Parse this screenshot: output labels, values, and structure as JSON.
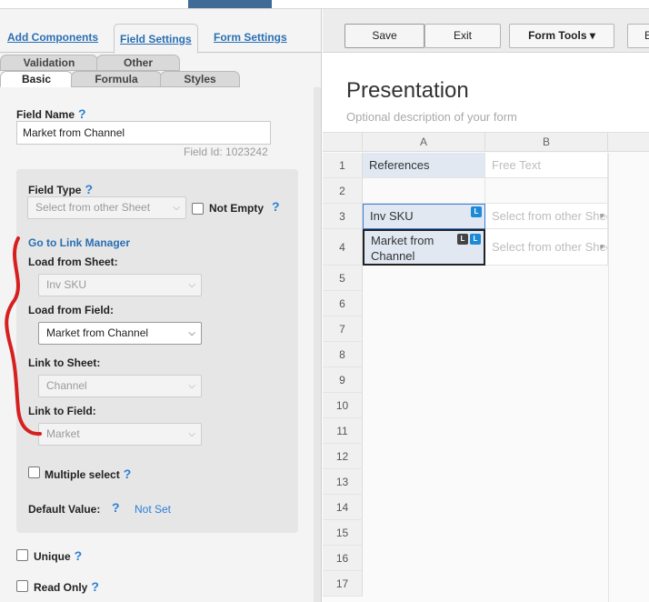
{
  "top_tabs": {
    "add_components": "Add Components",
    "field_settings": "Field Settings",
    "form_settings": "Form Settings"
  },
  "sub_tabs": {
    "validation": "Validation",
    "other": "Other",
    "basic": "Basic",
    "formula": "Formula",
    "styles": "Styles"
  },
  "field": {
    "name_label": "Field Name",
    "name_value": "Market from Channel",
    "field_id": "Field Id: 1023242",
    "type_label": "Field Type",
    "type_value": "Select from other Sheet",
    "not_empty_label": "Not Empty",
    "link_manager": "Go to Link Manager",
    "load_sheet_label": "Load from Sheet:",
    "load_sheet_value": "Inv SKU",
    "load_field_label": "Load from Field:",
    "load_field_value": "Market from Channel",
    "link_sheet_label": "Link to Sheet:",
    "link_sheet_value": "Channel",
    "link_field_label": "Link to Field:",
    "link_field_value": "Market",
    "multiple_select_label": "Multiple select",
    "default_value_label": "Default Value:",
    "default_value": "Not Set",
    "unique_label": "Unique",
    "read_only_label": "Read Only",
    "help": "?"
  },
  "toolbar": {
    "save": "Save",
    "exit": "Exit",
    "form_tools": "Form Tools",
    "caret": "▾",
    "partial": "E"
  },
  "form": {
    "title": "Presentation",
    "description": "Optional description of your form"
  },
  "grid": {
    "col_a": "A",
    "col_b": "B",
    "rows": [
      "1",
      "2",
      "3",
      "4",
      "5",
      "6",
      "7",
      "8",
      "9",
      "10",
      "11",
      "12",
      "13",
      "14",
      "15",
      "16",
      "17"
    ],
    "a1": "References",
    "b1": "Free Text",
    "a3": "Inv SKU",
    "b3": "Select from other Sheet",
    "a4": "Market from Channel",
    "b4": "Select from other Sheet",
    "badge_l": "L"
  },
  "colors": {
    "link_blue": "#2a6fb3",
    "help_blue": "#2a7fd6",
    "annotation_red": "#d62020"
  },
  "icons": {
    "dropdown": "chevron-down-icon",
    "help": "help-icon"
  }
}
